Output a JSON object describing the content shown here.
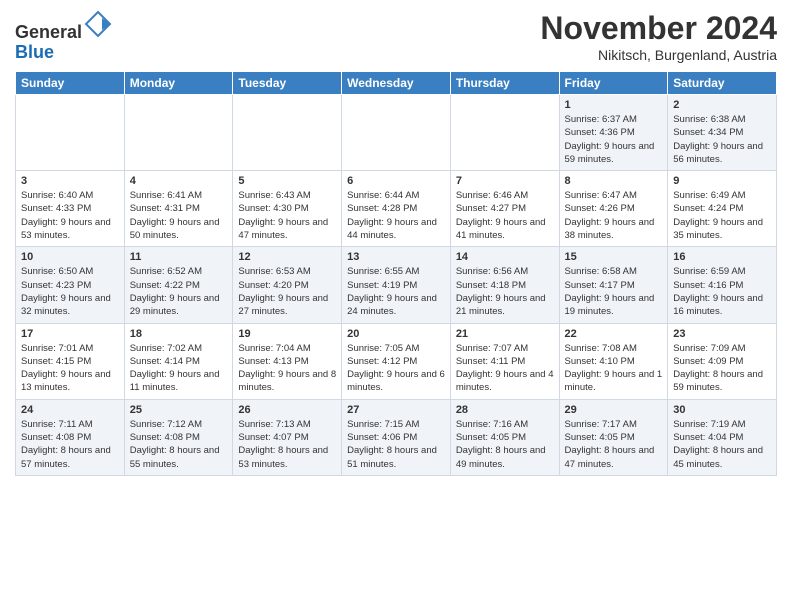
{
  "logo": {
    "line1": "General",
    "line2": "Blue"
  },
  "title": "November 2024",
  "location": "Nikitsch, Burgenland, Austria",
  "weekdays": [
    "Sunday",
    "Monday",
    "Tuesday",
    "Wednesday",
    "Thursday",
    "Friday",
    "Saturday"
  ],
  "weeks": [
    [
      {
        "day": "",
        "info": ""
      },
      {
        "day": "",
        "info": ""
      },
      {
        "day": "",
        "info": ""
      },
      {
        "day": "",
        "info": ""
      },
      {
        "day": "",
        "info": ""
      },
      {
        "day": "1",
        "info": "Sunrise: 6:37 AM\nSunset: 4:36 PM\nDaylight: 9 hours and 59 minutes."
      },
      {
        "day": "2",
        "info": "Sunrise: 6:38 AM\nSunset: 4:34 PM\nDaylight: 9 hours and 56 minutes."
      }
    ],
    [
      {
        "day": "3",
        "info": "Sunrise: 6:40 AM\nSunset: 4:33 PM\nDaylight: 9 hours and 53 minutes."
      },
      {
        "day": "4",
        "info": "Sunrise: 6:41 AM\nSunset: 4:31 PM\nDaylight: 9 hours and 50 minutes."
      },
      {
        "day": "5",
        "info": "Sunrise: 6:43 AM\nSunset: 4:30 PM\nDaylight: 9 hours and 47 minutes."
      },
      {
        "day": "6",
        "info": "Sunrise: 6:44 AM\nSunset: 4:28 PM\nDaylight: 9 hours and 44 minutes."
      },
      {
        "day": "7",
        "info": "Sunrise: 6:46 AM\nSunset: 4:27 PM\nDaylight: 9 hours and 41 minutes."
      },
      {
        "day": "8",
        "info": "Sunrise: 6:47 AM\nSunset: 4:26 PM\nDaylight: 9 hours and 38 minutes."
      },
      {
        "day": "9",
        "info": "Sunrise: 6:49 AM\nSunset: 4:24 PM\nDaylight: 9 hours and 35 minutes."
      }
    ],
    [
      {
        "day": "10",
        "info": "Sunrise: 6:50 AM\nSunset: 4:23 PM\nDaylight: 9 hours and 32 minutes."
      },
      {
        "day": "11",
        "info": "Sunrise: 6:52 AM\nSunset: 4:22 PM\nDaylight: 9 hours and 29 minutes."
      },
      {
        "day": "12",
        "info": "Sunrise: 6:53 AM\nSunset: 4:20 PM\nDaylight: 9 hours and 27 minutes."
      },
      {
        "day": "13",
        "info": "Sunrise: 6:55 AM\nSunset: 4:19 PM\nDaylight: 9 hours and 24 minutes."
      },
      {
        "day": "14",
        "info": "Sunrise: 6:56 AM\nSunset: 4:18 PM\nDaylight: 9 hours and 21 minutes."
      },
      {
        "day": "15",
        "info": "Sunrise: 6:58 AM\nSunset: 4:17 PM\nDaylight: 9 hours and 19 minutes."
      },
      {
        "day": "16",
        "info": "Sunrise: 6:59 AM\nSunset: 4:16 PM\nDaylight: 9 hours and 16 minutes."
      }
    ],
    [
      {
        "day": "17",
        "info": "Sunrise: 7:01 AM\nSunset: 4:15 PM\nDaylight: 9 hours and 13 minutes."
      },
      {
        "day": "18",
        "info": "Sunrise: 7:02 AM\nSunset: 4:14 PM\nDaylight: 9 hours and 11 minutes."
      },
      {
        "day": "19",
        "info": "Sunrise: 7:04 AM\nSunset: 4:13 PM\nDaylight: 9 hours and 8 minutes."
      },
      {
        "day": "20",
        "info": "Sunrise: 7:05 AM\nSunset: 4:12 PM\nDaylight: 9 hours and 6 minutes."
      },
      {
        "day": "21",
        "info": "Sunrise: 7:07 AM\nSunset: 4:11 PM\nDaylight: 9 hours and 4 minutes."
      },
      {
        "day": "22",
        "info": "Sunrise: 7:08 AM\nSunset: 4:10 PM\nDaylight: 9 hours and 1 minute."
      },
      {
        "day": "23",
        "info": "Sunrise: 7:09 AM\nSunset: 4:09 PM\nDaylight: 8 hours and 59 minutes."
      }
    ],
    [
      {
        "day": "24",
        "info": "Sunrise: 7:11 AM\nSunset: 4:08 PM\nDaylight: 8 hours and 57 minutes."
      },
      {
        "day": "25",
        "info": "Sunrise: 7:12 AM\nSunset: 4:08 PM\nDaylight: 8 hours and 55 minutes."
      },
      {
        "day": "26",
        "info": "Sunrise: 7:13 AM\nSunset: 4:07 PM\nDaylight: 8 hours and 53 minutes."
      },
      {
        "day": "27",
        "info": "Sunrise: 7:15 AM\nSunset: 4:06 PM\nDaylight: 8 hours and 51 minutes."
      },
      {
        "day": "28",
        "info": "Sunrise: 7:16 AM\nSunset: 4:05 PM\nDaylight: 8 hours and 49 minutes."
      },
      {
        "day": "29",
        "info": "Sunrise: 7:17 AM\nSunset: 4:05 PM\nDaylight: 8 hours and 47 minutes."
      },
      {
        "day": "30",
        "info": "Sunrise: 7:19 AM\nSunset: 4:04 PM\nDaylight: 8 hours and 45 minutes."
      }
    ]
  ]
}
